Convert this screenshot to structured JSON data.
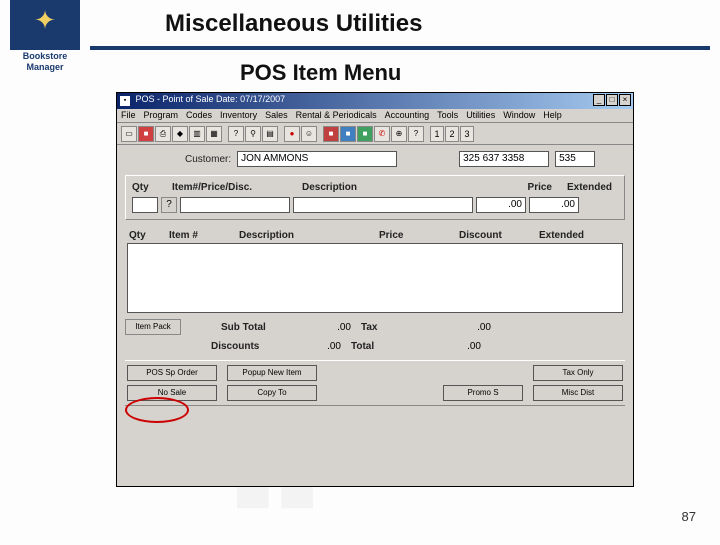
{
  "logo": {
    "brand_line1": "Bookstore",
    "brand_line2": "Manager"
  },
  "header": {
    "title": "Miscellaneous Utilities",
    "subtitle": "POS Item Menu"
  },
  "window": {
    "title": "POS - Point of Sale   Date: 07/17/2007",
    "menus": [
      "File",
      "Program",
      "Codes",
      "Inventory",
      "Sales",
      "Rental & Periodicals",
      "Accounting",
      "Tools",
      "Utilities",
      "Window",
      "Help"
    ],
    "toolbar_nums": [
      "1",
      "2",
      "3"
    ]
  },
  "customer": {
    "label": "Customer:",
    "name": "JON AMMONS",
    "phone": "325 637 3358",
    "code": "535"
  },
  "entry": {
    "headers": {
      "qty": "Qty",
      "item": "Item#/Price/Disc.",
      "desc": "Description",
      "price": "Price",
      "ext": "Extended"
    },
    "qmark": "?",
    "values": {
      "qty": "",
      "item": "",
      "desc": "",
      "price": ".00",
      "ext": ".00"
    }
  },
  "grid": {
    "headers": {
      "qty": "Qty",
      "item": "Item #",
      "desc": "Description",
      "price": "Price",
      "disc": "Discount",
      "ext": "Extended"
    }
  },
  "totals": {
    "item_pack_btn": "Item Pack",
    "subtotal_label": "Sub Total",
    "subtotal": ".00",
    "tax_label": "Tax",
    "tax": ".00",
    "discounts_label": "Discounts",
    "discounts": ".00",
    "total_label": "Total",
    "total": ".00"
  },
  "buttons": {
    "row1": {
      "a": "POS Sp Order",
      "b": "Popup New Item",
      "c": "Tax Only"
    },
    "row2": {
      "a": "No Sale",
      "b": "Copy To",
      "c": "Promo S",
      "d": "Misc Dist"
    }
  },
  "page_number": "87"
}
